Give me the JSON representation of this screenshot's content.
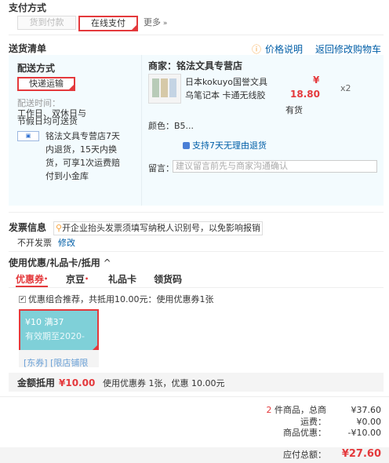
{
  "payment": {
    "title": "支付方式",
    "cod": "货到付款",
    "online": "在线支付",
    "more": "更多"
  },
  "shipping_list": {
    "title": "送货清单",
    "price_note": "价格说明",
    "back_cart": "返回修改购物车"
  },
  "delivery": {
    "title": "配送方式",
    "method": "快递运输",
    "time_label": "配送时间：",
    "time_line1": "工作日、双休日与",
    "time_line2": "节假日均可送货",
    "service_line1": "铭法文具专营店7天",
    "service_line2": "内退货，15天内换",
    "service_line3": "货，可享1次运费赔",
    "service_line4": "付到小金库"
  },
  "seller": {
    "label": "商家：铭法文具专营店",
    "item_name_line1": "日本kokuyo国誉文具",
    "item_name_line2": "乌笔记本 卡通无线胶",
    "price_sym": "¥",
    "price": "18.80",
    "qty": "x2",
    "stock": "有货",
    "color": "颜色：B5...",
    "return_note": "支持7天无理由退货",
    "msg_label": "留言：",
    "msg_placeholder": "建议留言前先与商家沟通确认"
  },
  "invoice": {
    "title": "发票信息",
    "tip": "开企业抬头发票须填写纳税人识别号，以免影响报销",
    "status": "不开发票",
    "edit": "修改"
  },
  "coupon_section": {
    "title": "使用优惠/礼品卡/抵用",
    "tabs": [
      "优惠券",
      "京豆",
      "礼品卡",
      "领货码"
    ],
    "recommend": "优惠组合推荐，共抵用10.00元：使用优惠券1张",
    "coupon_value": "¥10 满37",
    "coupon_expire": "有效期至2020-",
    "coupon_scope": "[东券] [限店铺限",
    "total_label": "金额抵用",
    "total_amount": "¥10.00",
    "total_detail": "使用优惠券 1张，优惠 10.00元"
  },
  "summary": {
    "count": "2",
    "count_text": "件商品，总商",
    "goods_total": "¥37.60",
    "freight_label": "运费：",
    "freight": "¥0.00",
    "discount_label": "商品优惠：",
    "discount": "-¥10.00",
    "payable_label": "应付总额：",
    "payable": "¥27.60"
  },
  "colors": {
    "accent": "#e4393c",
    "link": "#005ea7",
    "box_bg": "#f3fbfe"
  }
}
